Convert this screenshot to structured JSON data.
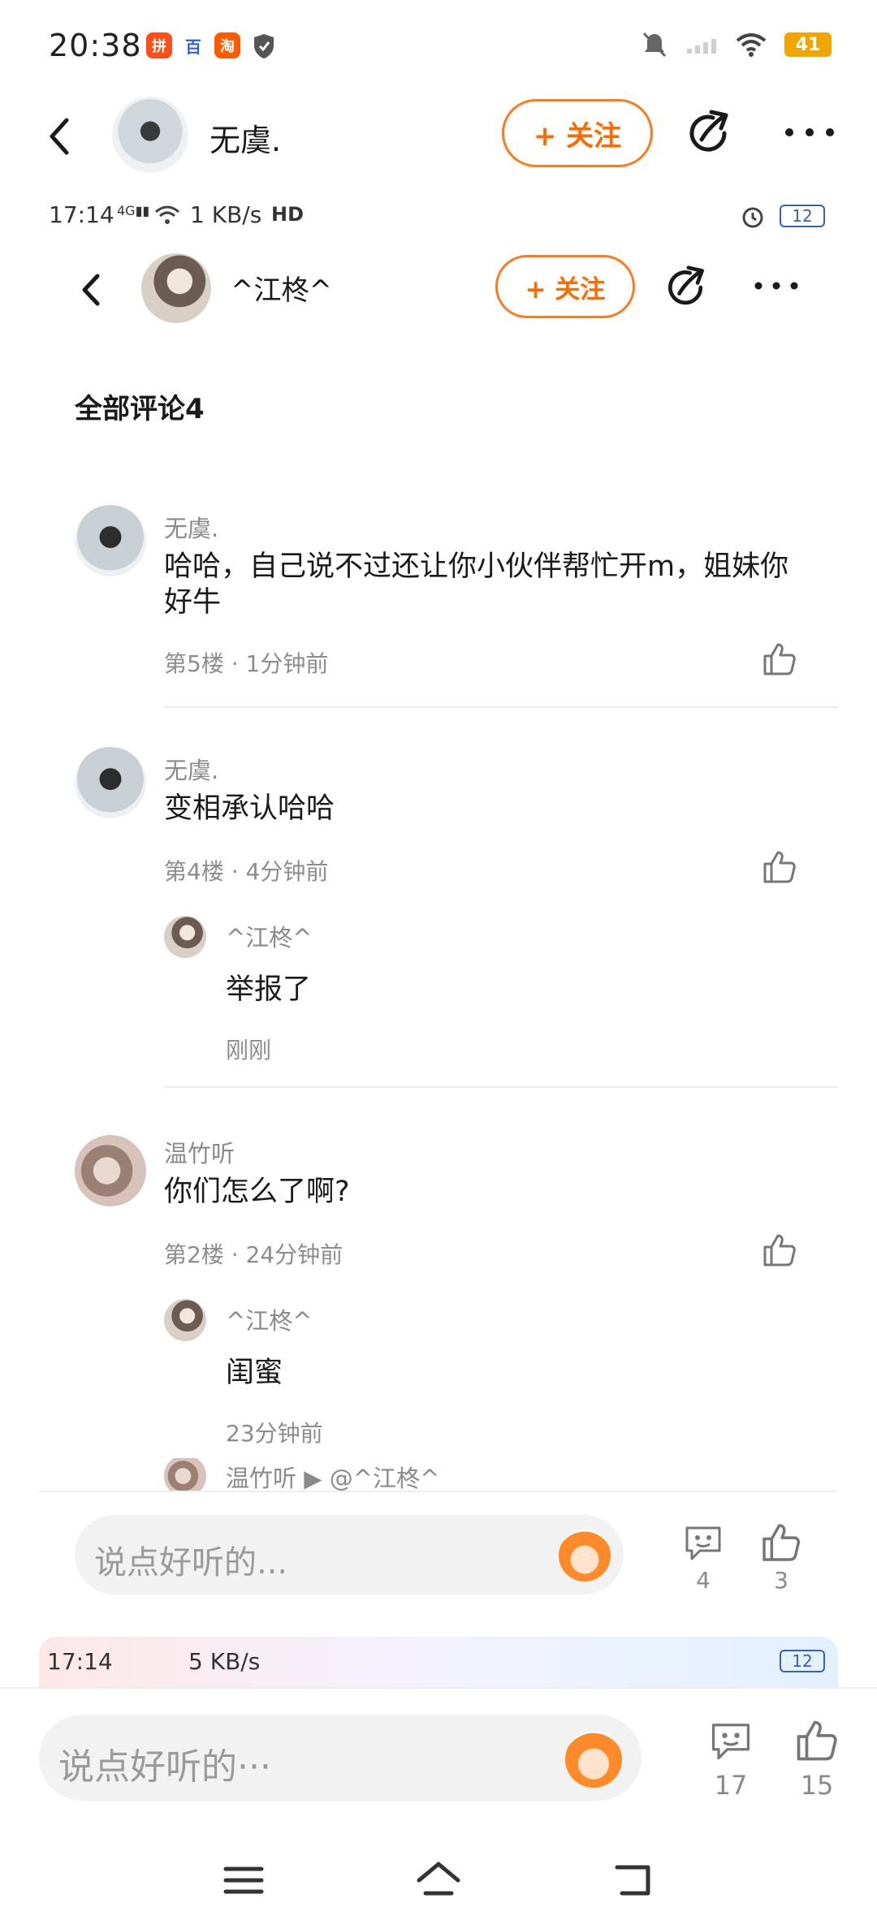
{
  "status_bar": {
    "time": "20:38",
    "battery": "41",
    "app_icons": [
      "拼",
      "百",
      "淘"
    ]
  },
  "outer_header": {
    "name": "无虞.",
    "follow_label": "+ 关注"
  },
  "inner_status": {
    "time": "17:14",
    "speed": "1 KB/s",
    "battery": "12"
  },
  "inner_header": {
    "name": "^江柊^",
    "follow_label": "+ 关注"
  },
  "section": {
    "title": "全部评论4"
  },
  "comments": [
    {
      "user": "无虞.",
      "text": "哈哈，自己说不过还让你小伙伴帮忙开m，姐妹你好牛",
      "meta": "第5楼 · 1分钟前"
    },
    {
      "user": "无虞.",
      "text": "变相承认哈哈",
      "meta": "第4楼 · 4分钟前",
      "reply": {
        "user": "^江柊^",
        "text": "举报了",
        "meta": "刚刚"
      }
    },
    {
      "user": "温竹听",
      "text": "你们怎么了啊?",
      "meta": "第2楼 · 24分钟前",
      "reply": {
        "user": "^江柊^",
        "text": "闺蜜",
        "meta": "23分钟前"
      },
      "partial_reply": {
        "user": "温竹听 ▶ @^江柊^"
      }
    }
  ],
  "inner_bottom": {
    "placeholder": "说点好听的...",
    "comment_count": "4",
    "like_count": "3"
  },
  "preview_strip": {
    "time": "17:14",
    "speed": "5 KB/s",
    "battery": "12"
  },
  "outer_bottom": {
    "placeholder": "说点好听的···",
    "comment_count": "17",
    "like_count": "15"
  },
  "colors": {
    "accent": "#ff6a00",
    "text": "#1a1a1a",
    "muted": "#8a8a8a"
  },
  "icons": [
    "back-arrow-icon",
    "share-icon",
    "more-dots-icon",
    "like-thumb-icon",
    "comment-bubble-icon",
    "menu-icon",
    "home-icon",
    "back-nav-icon"
  ]
}
